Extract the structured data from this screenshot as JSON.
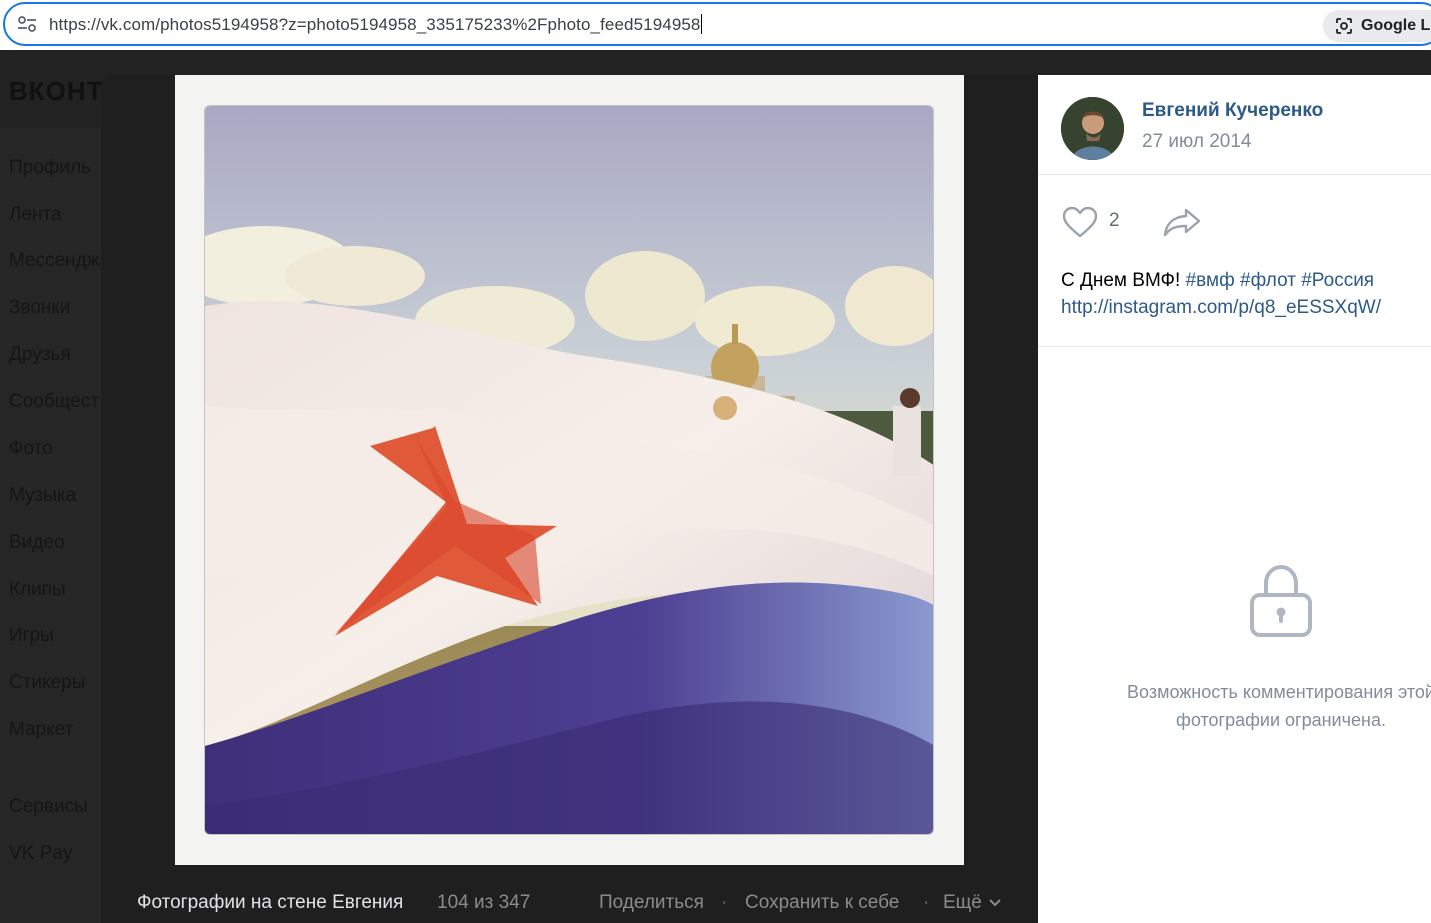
{
  "browser": {
    "url": "https://vk.com/photos5194958?z=photo5194958_335175233%2Fphoto_feed5194958",
    "lens_label": "Google Le"
  },
  "vk": {
    "logo": "ВКОНТ",
    "sidebar": {
      "items": [
        {
          "label": "Профиль"
        },
        {
          "label": "Лента"
        },
        {
          "label": "Мессендж"
        },
        {
          "label": "Звонки"
        },
        {
          "label": "Друзья"
        },
        {
          "label": "Сообщест"
        },
        {
          "label": "Фото"
        },
        {
          "label": "Музыка"
        },
        {
          "label": "Видео"
        },
        {
          "label": "Клипы"
        },
        {
          "label": "Игры"
        },
        {
          "label": "Стикеры"
        },
        {
          "label": "Маркет"
        },
        {
          "label": "Сервисы"
        },
        {
          "label": "VK Pay"
        }
      ]
    }
  },
  "viewer": {
    "album_title": "Фотографии на стене Евгения",
    "counter": "104 из 347",
    "actions": {
      "share": "Поделиться",
      "save": "Сохранить к себе",
      "more": "Ещё",
      "separator": "·"
    }
  },
  "post": {
    "author": "Евгений Кучеренко",
    "date": "27 июл 2014",
    "likes": "2",
    "text": "С Днем ВМФ!",
    "hashtags": [
      "#вмф",
      "#флот",
      "#Россия"
    ],
    "link": "http://instagram.com/p/q8_eESSXqW/",
    "comments_restricted": "Возможность комментирования этой фотографии ограничена."
  },
  "colors": {
    "link": "#2c5a87",
    "muted": "#818c99",
    "address_focus": "#1a73e8"
  }
}
